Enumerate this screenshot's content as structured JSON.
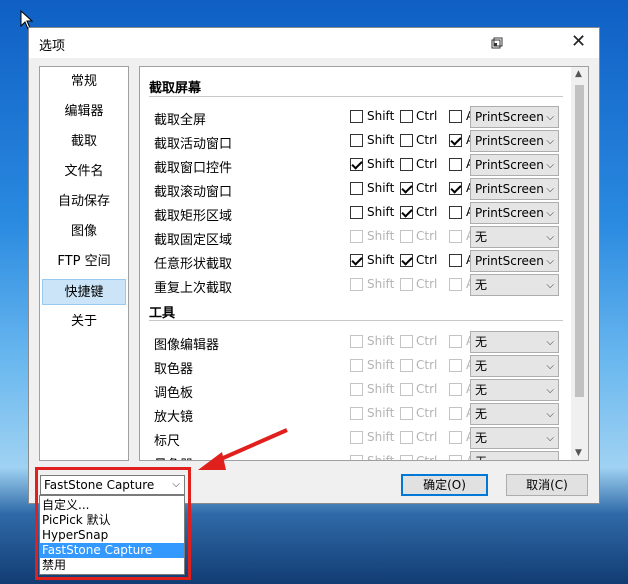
{
  "window": {
    "title": "选项"
  },
  "nav": {
    "items": [
      "常规",
      "编辑器",
      "截取",
      "文件名",
      "自动保存",
      "图像",
      "FTP 空间",
      "快捷键",
      "关于"
    ],
    "selected_index": 7
  },
  "modifiers": [
    "Shift",
    "Ctrl",
    "Alt"
  ],
  "sections": {
    "capture": {
      "title": "截取屏幕",
      "rows": [
        {
          "label": "截取全屏",
          "enabled": true,
          "shift": false,
          "ctrl": false,
          "alt": false,
          "key": "PrintScreen"
        },
        {
          "label": "截取活动窗口",
          "enabled": true,
          "shift": false,
          "ctrl": false,
          "alt": true,
          "key": "PrintScreen"
        },
        {
          "label": "截取窗口控件",
          "enabled": true,
          "shift": true,
          "ctrl": false,
          "alt": false,
          "key": "PrintScreen"
        },
        {
          "label": "截取滚动窗口",
          "enabled": true,
          "shift": false,
          "ctrl": true,
          "alt": true,
          "key": "PrintScreen"
        },
        {
          "label": "截取矩形区域",
          "enabled": true,
          "shift": false,
          "ctrl": true,
          "alt": false,
          "key": "PrintScreen"
        },
        {
          "label": "截取固定区域",
          "enabled": false,
          "shift": false,
          "ctrl": false,
          "alt": false,
          "key": "无"
        },
        {
          "label": "任意形状截取",
          "enabled": true,
          "shift": true,
          "ctrl": true,
          "alt": false,
          "key": "PrintScreen"
        },
        {
          "label": "重复上次截取",
          "enabled": false,
          "shift": false,
          "ctrl": false,
          "alt": false,
          "key": "无"
        }
      ]
    },
    "tools": {
      "title": "工具",
      "rows": [
        {
          "label": "图像编辑器",
          "enabled": false,
          "shift": false,
          "ctrl": false,
          "alt": false,
          "key": "无"
        },
        {
          "label": "取色器",
          "enabled": false,
          "shift": false,
          "ctrl": false,
          "alt": false,
          "key": "无"
        },
        {
          "label": "调色板",
          "enabled": false,
          "shift": false,
          "ctrl": false,
          "alt": false,
          "key": "无"
        },
        {
          "label": "放大镜",
          "enabled": false,
          "shift": false,
          "ctrl": false,
          "alt": false,
          "key": "无"
        },
        {
          "label": "标尺",
          "enabled": false,
          "shift": false,
          "ctrl": false,
          "alt": false,
          "key": "无"
        },
        {
          "label": "量角器",
          "enabled": false,
          "shift": false,
          "ctrl": false,
          "alt": false,
          "key": "无"
        }
      ]
    }
  },
  "preset": {
    "selected": "FastStone Capture",
    "options": [
      "自定义...",
      "PicPick 默认",
      "HyperSnap",
      "FastStone Capture",
      "禁用"
    ],
    "highlighted_index": 3
  },
  "buttons": {
    "ok": "确定(O)",
    "cancel": "取消(C)"
  },
  "icons": {
    "close": "close-icon",
    "restore": "restore-icon",
    "dropdown": "chevron-down-icon"
  },
  "colors": {
    "selection": "#3399ff",
    "highlight": "#e0201c",
    "nav_selected": "#cce4f7"
  }
}
